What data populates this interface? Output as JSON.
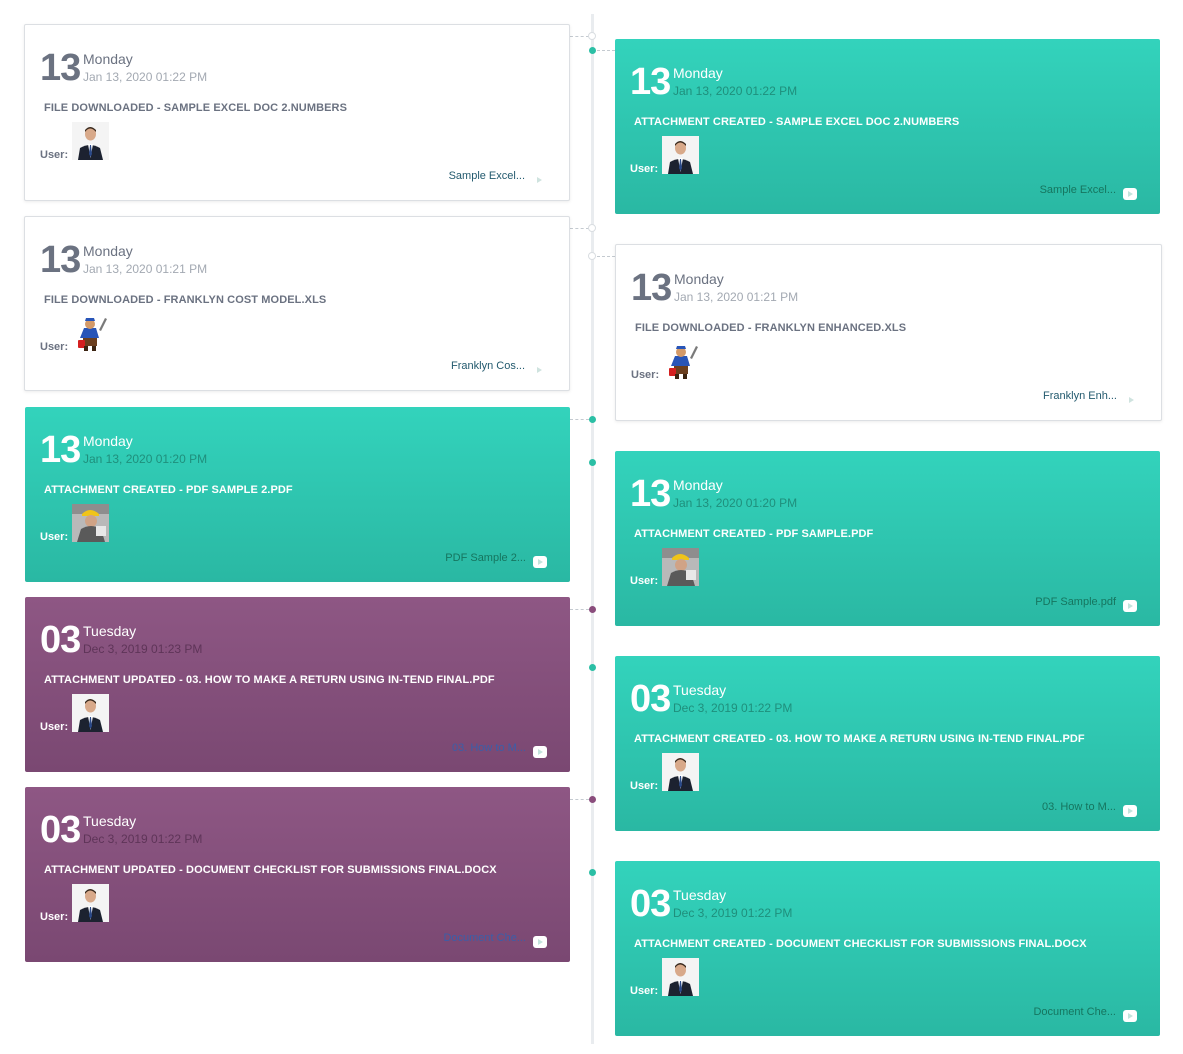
{
  "colors": {
    "teal": "#33d3bc",
    "purple": "#8a4d7c",
    "white": "#ffffff",
    "axis": "#e9ecef"
  },
  "labels": {
    "user": "User:"
  },
  "events": [
    {
      "day": "13",
      "weekday": "Monday",
      "datetime": "Jan 13, 2020 01:22 PM",
      "title": "FILE DOWNLOADED - SAMPLE EXCEL DOC 2.NUMBERS",
      "link": "Sample Excel...",
      "style": "white",
      "avatar": "businessman-avatar"
    },
    {
      "day": "13",
      "weekday": "Monday",
      "datetime": "Jan 13, 2020 01:22 PM",
      "title": "ATTACHMENT CREATED - SAMPLE EXCEL DOC 2.NUMBERS",
      "link": "Sample Excel...",
      "style": "teal",
      "avatar": "businessman-avatar"
    },
    {
      "day": "13",
      "weekday": "Monday",
      "datetime": "Jan 13, 2020 01:21 PM",
      "title": "FILE DOWNLOADED - FRANKLYN COST MODEL.XLS",
      "link": "Franklyn Cos...",
      "style": "white",
      "avatar": "plumber-avatar"
    },
    {
      "day": "13",
      "weekday": "Monday",
      "datetime": "Jan 13, 2020 01:21 PM",
      "title": "FILE DOWNLOADED - FRANKLYN ENHANCED.XLS",
      "link": "Franklyn Enh...",
      "style": "white",
      "avatar": "plumber-avatar"
    },
    {
      "day": "13",
      "weekday": "Monday",
      "datetime": "Jan 13, 2020 01:20 PM",
      "title": "ATTACHMENT CREATED - PDF SAMPLE 2.PDF",
      "link": "PDF Sample 2...",
      "style": "teal",
      "avatar": "worker-avatar"
    },
    {
      "day": "13",
      "weekday": "Monday",
      "datetime": "Jan 13, 2020 01:20 PM",
      "title": "ATTACHMENT CREATED - PDF SAMPLE.PDF",
      "link": "PDF Sample.pdf",
      "style": "teal",
      "avatar": "worker-avatar"
    },
    {
      "day": "03",
      "weekday": "Tuesday",
      "datetime": "Dec 3, 2019 01:23 PM",
      "title": "ATTACHMENT UPDATED - 03. HOW TO MAKE A RETURN USING IN-TEND FINAL.PDF",
      "link": "03. How to M...",
      "style": "purple",
      "avatar": "businessman-avatar"
    },
    {
      "day": "03",
      "weekday": "Tuesday",
      "datetime": "Dec 3, 2019 01:22 PM",
      "title": "ATTACHMENT CREATED - 03. HOW TO MAKE A RETURN USING IN-TEND FINAL.PDF",
      "link": "03. How to M...",
      "style": "teal",
      "avatar": "businessman-avatar"
    },
    {
      "day": "03",
      "weekday": "Tuesday",
      "datetime": "Dec 3, 2019 01:22 PM",
      "title": "ATTACHMENT UPDATED - DOCUMENT CHECKLIST FOR SUBMISSIONS FINAL.DOCX",
      "link": "Document Che...",
      "style": "purple",
      "avatar": "businessman-avatar"
    },
    {
      "day": "03",
      "weekday": "Tuesday",
      "datetime": "Dec 3, 2019 01:22 PM",
      "title": "ATTACHMENT CREATED - DOCUMENT CHECKLIST FOR SUBMISSIONS FINAL.DOCX",
      "link": "Document Che...",
      "style": "teal",
      "avatar": "businessman-avatar"
    }
  ]
}
